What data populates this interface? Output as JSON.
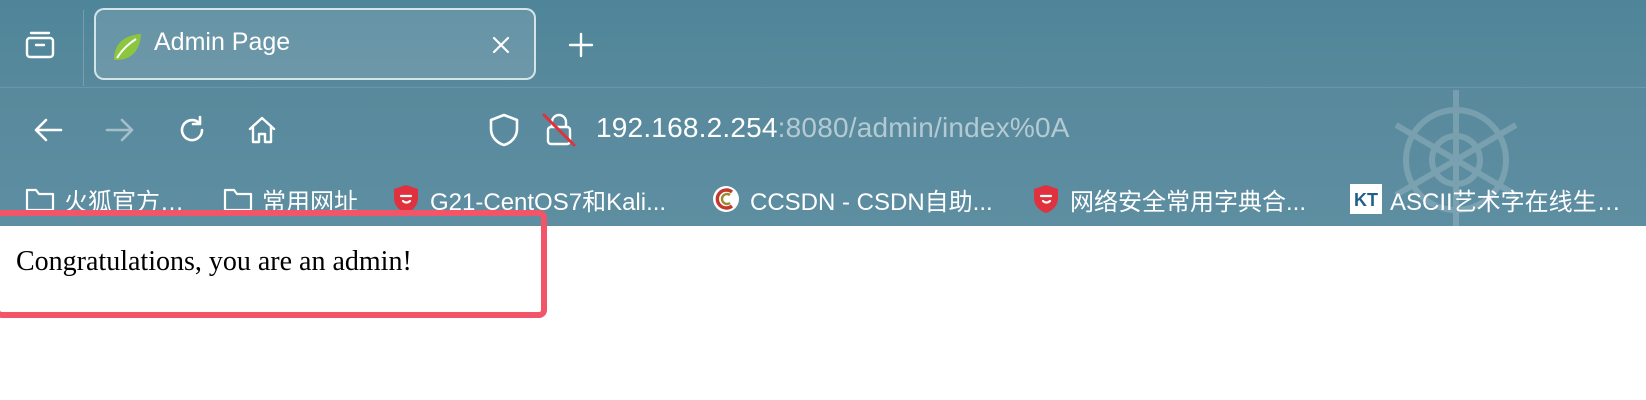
{
  "window": {
    "tab": {
      "title": "Admin Page",
      "favicon": "spring-leaf-icon",
      "close_icon": "close-icon"
    },
    "tab_list_icon": "tab-list-icon",
    "new_tab_icon": "plus-icon"
  },
  "nav": {
    "back_icon": "arrow-left-icon",
    "forward_icon": "arrow-right-icon",
    "reload_icon": "reload-icon",
    "home_icon": "home-icon",
    "security_icon": "shield-icon",
    "lock_icon": "insecure-lock-icon",
    "url_host": "192.168.2.254",
    "url_rest": ":8080/admin/index%0A"
  },
  "bookmarks": [
    {
      "label": "火狐官方站点",
      "icon": "folder-icon"
    },
    {
      "label": "常用网址",
      "icon": "folder-icon"
    },
    {
      "label": "G21-CentOS7和Kali...",
      "icon": "shield-badge-icon"
    },
    {
      "label": "CCSDN - CSDN自助...",
      "icon": "c-logo-icon"
    },
    {
      "label": "网络安全常用字典合...",
      "icon": "shield-badge-icon"
    },
    {
      "label": "ASCII艺术字在线生成 ...",
      "icon": "kt-logo-icon"
    }
  ],
  "page": {
    "message": "Congratulations, you are an admin!"
  },
  "colors": {
    "toolbar": "#5a8c9f",
    "highlight": "#f25468",
    "bookmark_red": "#e0323e"
  }
}
